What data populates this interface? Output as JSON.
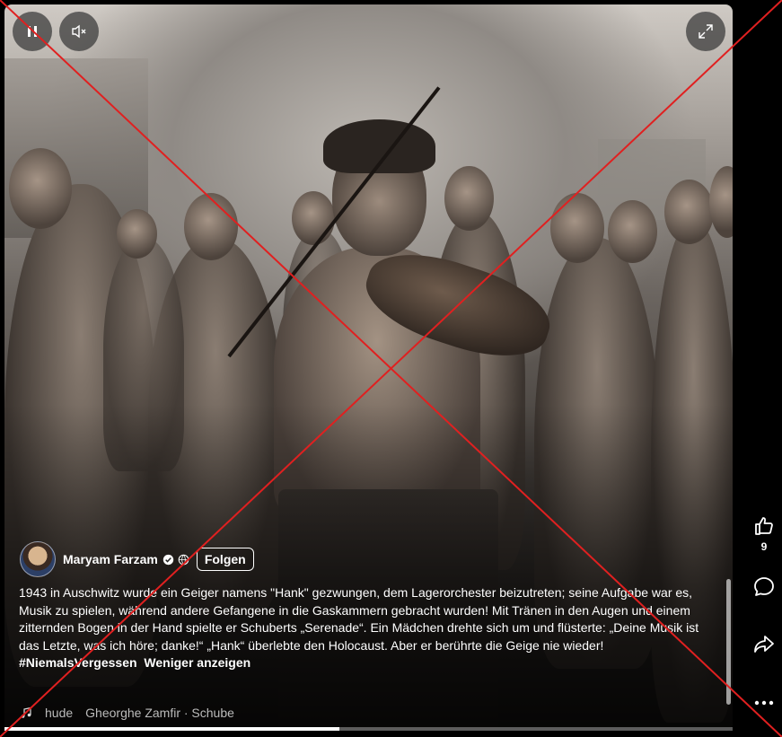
{
  "post": {
    "author_name": "Maryam Farzam",
    "follow_label": "Folgen",
    "caption": "1943 in Auschwitz wurde ein Geiger namens \"Hank\" gezwungen, dem Lagerorchester beizutreten; seine Aufgabe war es, Musik zu spielen, während andere Gefangene in die Gaskammern gebracht wurden! Mit Tränen in den Augen und einem zitternden Bogen in der Hand spielte er Schuberts „Serenade“. Ein Mädchen drehte sich um und flüsterte: „Deine Musik ist das Letzte, was ich höre; danke!“ „Hank“ überlebte den Holocaust. Aber er berührte die Geige nie wieder!",
    "hashtag": "#NiemalsVergessen",
    "show_less_label": "Weniger anzeigen",
    "audio_partial": "hude",
    "audio_track": "Gheorghe Zamfir · Schube",
    "like_count": "9"
  },
  "video": {
    "progress_fraction": 0.46
  },
  "icons": {
    "pause": "pause-icon",
    "mute": "speaker-muted-icon",
    "fullscreen": "fullscreen-icon",
    "verified": "verified-badge-icon",
    "visibility": "globe-icon",
    "audio": "music-note-icon",
    "like": "thumbs-up-icon",
    "comment": "comment-bubble-icon",
    "share": "share-arrow-icon",
    "more": "more-dots-icon"
  },
  "colors": {
    "overlay_cross": "#e02020",
    "background": "#000000"
  }
}
